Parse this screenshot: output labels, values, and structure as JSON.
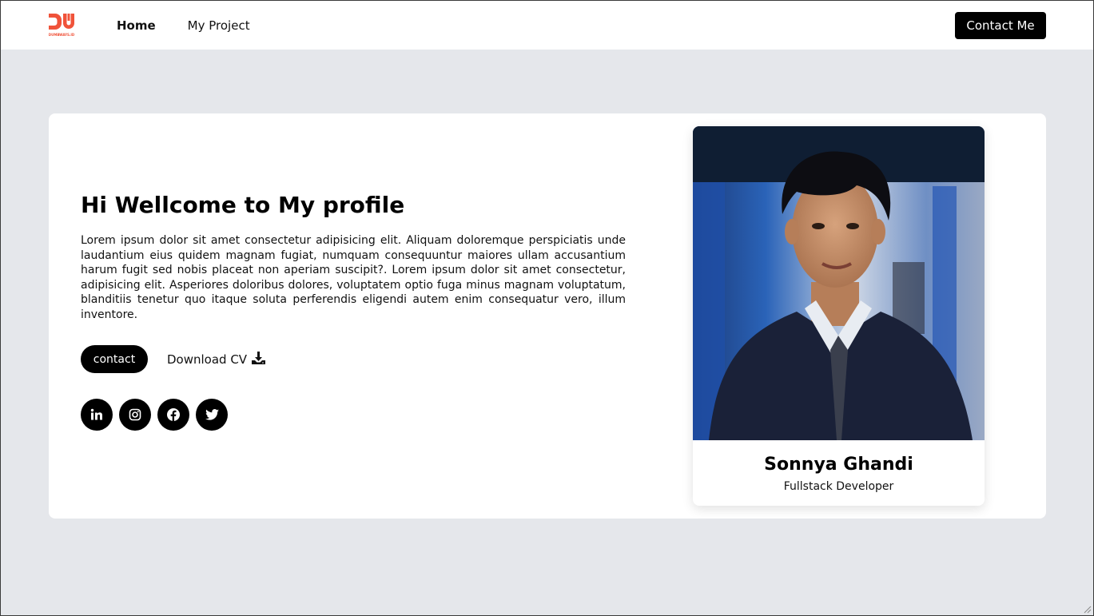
{
  "nav": {
    "logo_text": "DUMBWAYS.ID",
    "links": [
      {
        "label": "Home",
        "active": true
      },
      {
        "label": "My Project",
        "active": false
      }
    ],
    "contact_button": "Contact Me"
  },
  "hero": {
    "title": "Hi Wellcome to My profile",
    "description": "Lorem ipsum dolor sit amet consectetur adipisicing elit. Aliquam doloremque perspiciatis unde laudantium eius quidem magnam fugiat, numquam consequuntur maiores ullam accusantium harum fugit sed nobis placeat non aperiam suscipit?. Lorem ipsum dolor sit amet consectetur, adipisicing elit. Asperiores doloribus dolores, voluptatem optio fuga minus magnam voluptatum, blanditiis tenetur quo itaque soluta perferendis eligendi autem enim consequatur vero, illum inventore.",
    "contact_button": "contact",
    "download_cv": "Download CV",
    "socials": [
      "linkedin-icon",
      "instagram-icon",
      "facebook-icon",
      "twitter-icon"
    ]
  },
  "profile": {
    "name": "Sonnya Ghandi",
    "role": "Fullstack Developer"
  },
  "colors": {
    "page_bg": "#e5e7eb",
    "brand": "#f0533a",
    "button_bg": "#000000"
  }
}
